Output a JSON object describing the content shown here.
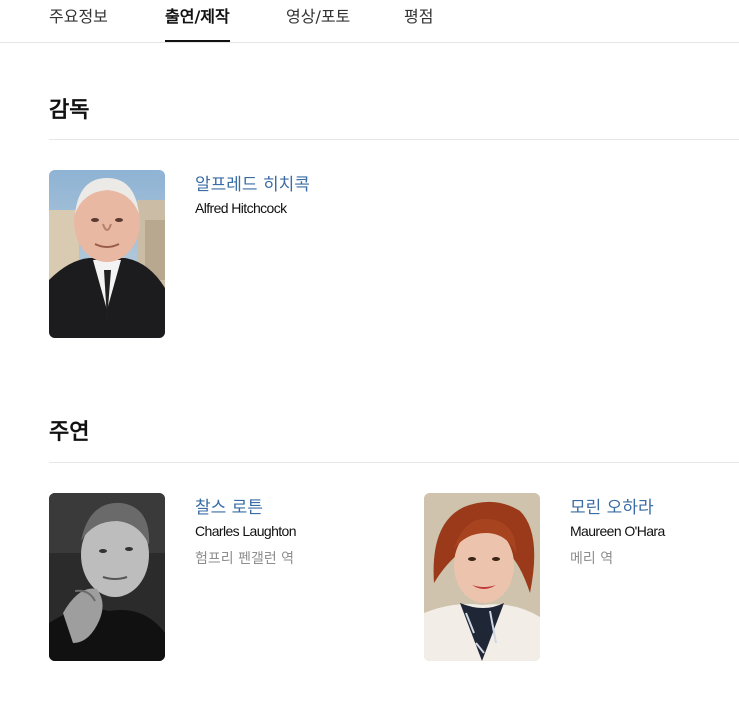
{
  "tabs": [
    {
      "label": "주요정보",
      "active": false
    },
    {
      "label": "출연/제작",
      "active": true
    },
    {
      "label": "영상/포토",
      "active": false
    },
    {
      "label": "평점",
      "active": false
    }
  ],
  "sections": {
    "director": {
      "title": "감독",
      "people": [
        {
          "name_ko": "알프레드 히치콕",
          "name_en": "Alfred Hitchcock"
        }
      ]
    },
    "cast": {
      "title": "주연",
      "people": [
        {
          "name_ko": "찰스 로튼",
          "name_en": "Charles Laughton",
          "role": "험프리 펜갤런 역"
        },
        {
          "name_ko": "모린 오하라",
          "name_en": "Maureen O'Hara",
          "role": "메리 역"
        }
      ]
    }
  },
  "colors": {
    "link": "#3a6ca5",
    "role_text": "#8e8e8e",
    "divider": "#e7e7e7"
  }
}
